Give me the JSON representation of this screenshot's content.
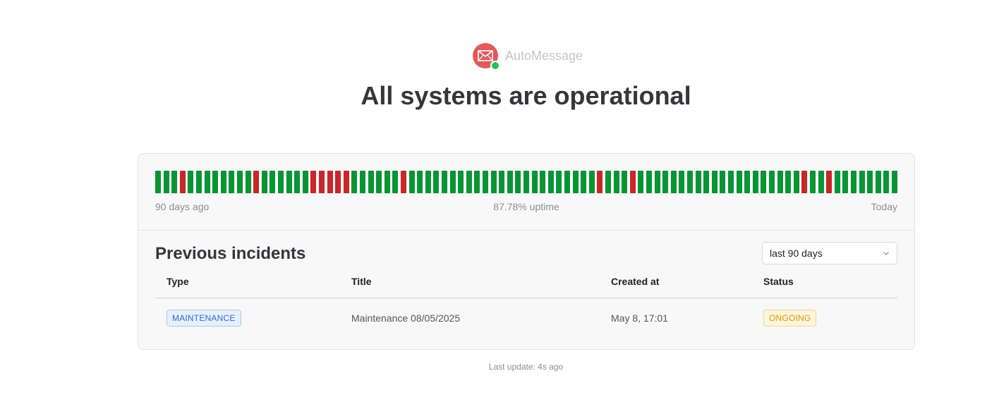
{
  "brand": {
    "name": "AutoMessage",
    "logo_icon": "envelope-icon",
    "status_dot_color": "#1fc15a"
  },
  "headline": "All systems are operational",
  "uptime": {
    "range_start_label": "90 days ago",
    "summary_label": "87.78% uptime",
    "range_end_label": "Today",
    "colors": {
      "up": "#0a9436",
      "down": "#c9262c"
    },
    "days": [
      "up",
      "up",
      "up",
      "down",
      "up",
      "up",
      "up",
      "up",
      "up",
      "up",
      "up",
      "up",
      "down",
      "up",
      "up",
      "up",
      "up",
      "up",
      "up",
      "down",
      "down",
      "down",
      "down",
      "down",
      "up",
      "up",
      "up",
      "up",
      "up",
      "up",
      "down",
      "up",
      "up",
      "up",
      "up",
      "up",
      "up",
      "up",
      "up",
      "up",
      "up",
      "up",
      "up",
      "up",
      "up",
      "up",
      "up",
      "up",
      "up",
      "up",
      "up",
      "up",
      "up",
      "up",
      "down",
      "up",
      "up",
      "up",
      "down",
      "up",
      "up",
      "up",
      "up",
      "up",
      "up",
      "up",
      "up",
      "up",
      "up",
      "up",
      "up",
      "up",
      "up",
      "up",
      "up",
      "up",
      "up",
      "up",
      "up",
      "down",
      "up",
      "up",
      "down",
      "up",
      "up",
      "up",
      "up",
      "up",
      "up",
      "up",
      "up"
    ]
  },
  "incidents": {
    "title": "Previous incidents",
    "filter": {
      "selected": "last 90 days"
    },
    "columns": [
      "Type",
      "Title",
      "Created at",
      "Status"
    ],
    "rows": [
      {
        "type": "MAINTENANCE",
        "title": "Maintenance 08/05/2025",
        "created_at": "May 8, 17:01",
        "status": "ONGOING"
      }
    ]
  },
  "footer": {
    "last_update": "Last update: 4s ago"
  }
}
